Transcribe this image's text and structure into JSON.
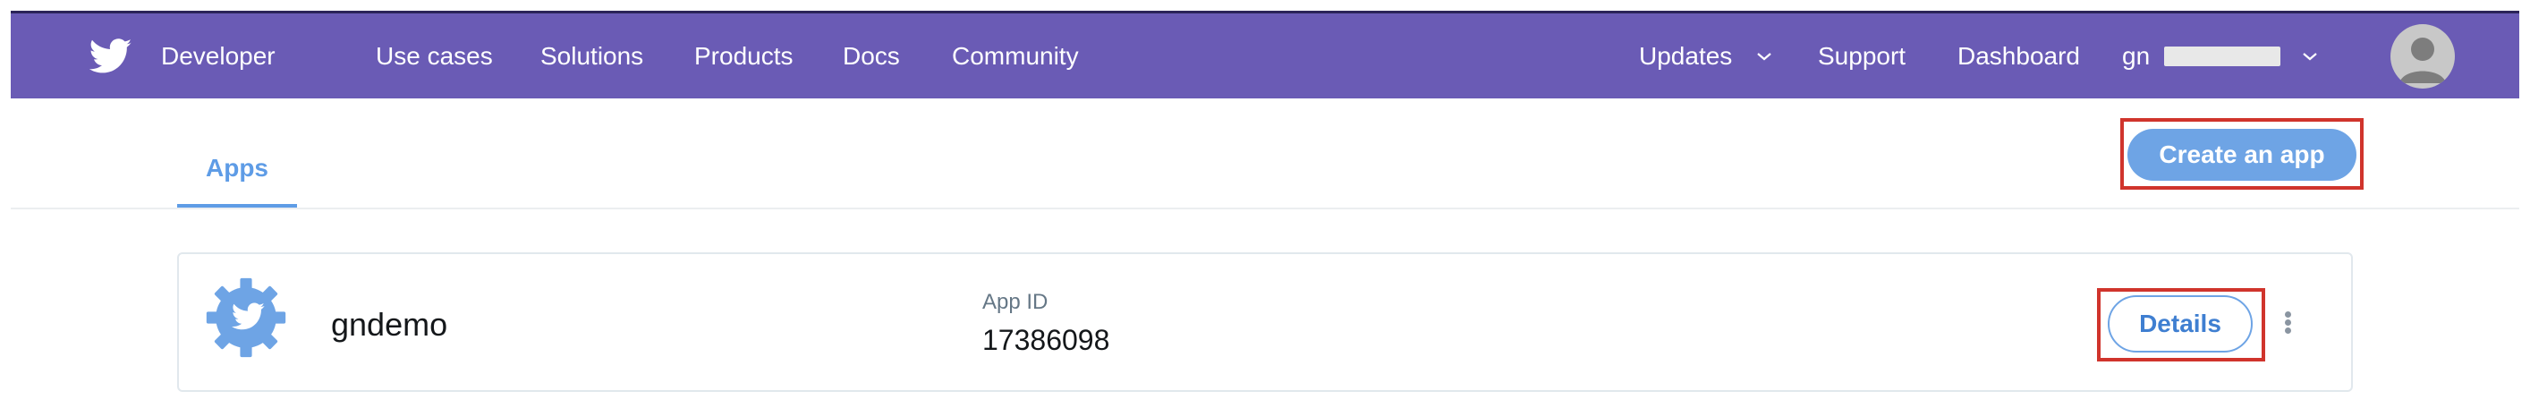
{
  "navbar": {
    "brand_label": "Developer",
    "links": [
      "Use cases",
      "Solutions",
      "Products",
      "Docs",
      "Community"
    ],
    "right_links": {
      "updates": "Updates",
      "support": "Support",
      "dashboard": "Dashboard",
      "username": "gn"
    },
    "background_color": "#6a5bb5"
  },
  "tabs": {
    "apps": "Apps"
  },
  "actions": {
    "create_app": "Create an app"
  },
  "apps": [
    {
      "name": "gndemo",
      "app_id_label": "App ID",
      "app_id": "17386098",
      "details_label": "Details"
    }
  ],
  "colors": {
    "accent": "#6ea4e5",
    "highlight": "#d0342c"
  }
}
